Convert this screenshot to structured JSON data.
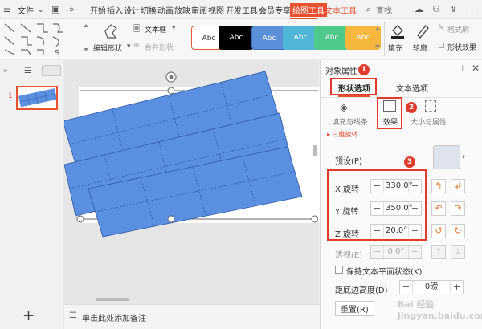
{
  "menubar": {
    "file": "文件",
    "tabs": [
      "开始",
      "插入",
      "设计",
      "切换",
      "动画",
      "放映",
      "审阅",
      "视图",
      "开发工具",
      "会员专享"
    ],
    "active_tab": "绘图工具",
    "text_tool_tab": "文本工具",
    "search": "查找"
  },
  "ribbon": {
    "edit_shape": "编辑形状",
    "text_box": "文本框",
    "merge_shape": "合并形状",
    "style_labels": [
      "Abc",
      "Abc",
      "Abc",
      "Abc",
      "Abc",
      "Abc"
    ],
    "style_colors": [
      "#ffffff",
      "#000000",
      "#5b8fd9",
      "#4fb6d9",
      "#4cc98b",
      "#f5b73c"
    ],
    "fill": "填充",
    "outline": "轮廓",
    "format_brush": "格式刷",
    "shape_effect": "形状效果"
  },
  "left_panel": {
    "slide_number": "1",
    "add": "+"
  },
  "notes": {
    "placeholder": "单击此处添加备注"
  },
  "right_panel": {
    "title": "对象属性",
    "tab_shape": "形状选项",
    "tab_text": "文本选项",
    "subtabs": {
      "fill_line": "填充与线条",
      "effect": "效果",
      "size_props": "大小与属性"
    },
    "section_3d_rotation": "三维旋转",
    "preset_label": "预设(P)",
    "x_label": "X 旋转",
    "x_value": "330.0°",
    "y_label": "Y 旋转",
    "y_value": "350.0°",
    "z_label": "Z 旋转",
    "z_value": "20.0°",
    "perspective_label": "透视(E)",
    "perspective_value": "0.0°",
    "keep_text_flat": "保持文本平面状态(K)",
    "bottom_distance_label": "距底边高度(D)",
    "bottom_distance_value": "0磅",
    "reset_label": "重置(R)",
    "badges": [
      "1",
      "2",
      "3"
    ]
  },
  "watermark": "Bai 经验 jingyan.baidu.com"
}
